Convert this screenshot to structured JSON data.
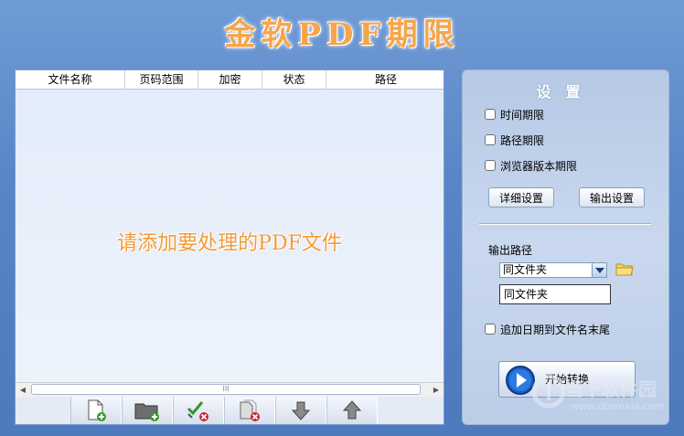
{
  "app_title": "金软PDF期限",
  "table": {
    "headers": [
      "文件名称",
      "页码范围",
      "加密",
      "状态",
      "路径"
    ],
    "empty_hint": "请添加要处理的PDF文件"
  },
  "scrollbar": {
    "left": "◀",
    "right": "▶",
    "grip": "III"
  },
  "toolbar": {
    "buttons": [
      "add-file",
      "add-folder",
      "clear-checked",
      "remove-all",
      "move-down",
      "move-up"
    ]
  },
  "settings": {
    "title": "设置",
    "time_limit": "时间期限",
    "path_limit": "路径期限",
    "browser_limit": "浏览器版本期限",
    "detail_btn": "详细设置",
    "output_btn": "输出设置",
    "output_path_label": "输出路径",
    "output_path_select": "同文件夹",
    "output_path_text": "同文件夹",
    "append_date": "追加日期到文件名末尾",
    "start_btn": "开始转换"
  },
  "watermark": {
    "line1": "当下软件园",
    "line2": "www.downxia.com"
  }
}
